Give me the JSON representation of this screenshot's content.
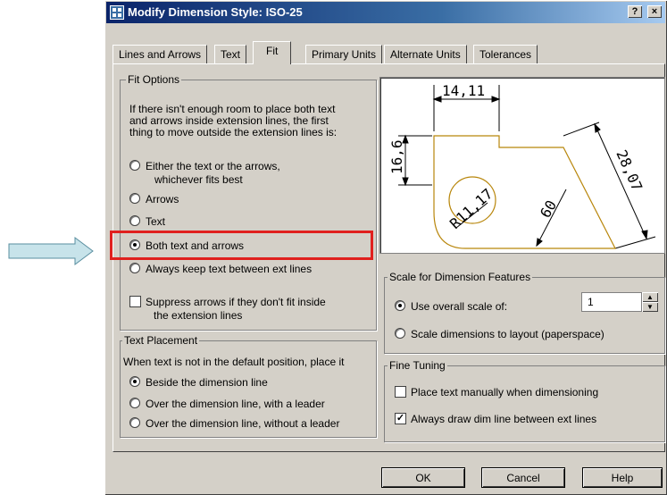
{
  "window": {
    "title": "Modify Dimension Style: ISO-25",
    "help_btn": "?",
    "close_btn": "×"
  },
  "tabs": [
    {
      "label": "Lines and Arrows"
    },
    {
      "label": "Text"
    },
    {
      "label": "Fit"
    },
    {
      "label": "Primary Units"
    },
    {
      "label": "Alternate Units"
    },
    {
      "label": "Tolerances"
    }
  ],
  "fit_options": {
    "legend": "Fit Options",
    "desc1": "If there isn't enough room to place both text",
    "desc2": "and arrows inside extension lines, the first",
    "desc3": "thing to move outside the extension lines is:",
    "radios": [
      {
        "label": "Either the text or the arrows,",
        "label2": "whichever fits best",
        "selected": false
      },
      {
        "label": "Arrows",
        "selected": false
      },
      {
        "label": "Text",
        "selected": false
      },
      {
        "label": "Both text and arrows",
        "selected": true
      },
      {
        "label": "Always keep text between ext lines",
        "selected": false
      }
    ],
    "suppress_label1": "Suppress arrows if they don't fit inside",
    "suppress_label2": "the extension lines",
    "suppress_checked": false
  },
  "text_placement": {
    "legend": "Text Placement",
    "desc": "When text is not in the default position, place it",
    "radios": [
      {
        "label": "Beside the dimension line",
        "selected": true
      },
      {
        "label": "Over the dimension line, with a leader",
        "selected": false
      },
      {
        "label": "Over the dimension line, without a leader",
        "selected": false
      }
    ]
  },
  "preview": {
    "dim_top": "14,11",
    "dim_left": "16,6",
    "dim_right": "28,07",
    "dim_angle": "60",
    "dim_radius": "R11,17"
  },
  "scale": {
    "legend": "Scale for Dimension Features",
    "overall_label": "Use overall scale of:",
    "overall_value": "1",
    "overall_selected": true,
    "layout_label": "Scale dimensions to layout (paperspace)",
    "layout_selected": false
  },
  "fine_tuning": {
    "legend": "Fine Tuning",
    "manual_label": "Place text manually when dimensioning",
    "manual_checked": false,
    "always_label": "Always draw dim line between ext lines",
    "always_checked": true
  },
  "buttons": {
    "ok": "OK",
    "cancel": "Cancel",
    "help": "Help"
  },
  "colors": {
    "highlight": "#e0201e",
    "arrow_fill": "#c7e3ea",
    "drawing": "#b8860b"
  }
}
